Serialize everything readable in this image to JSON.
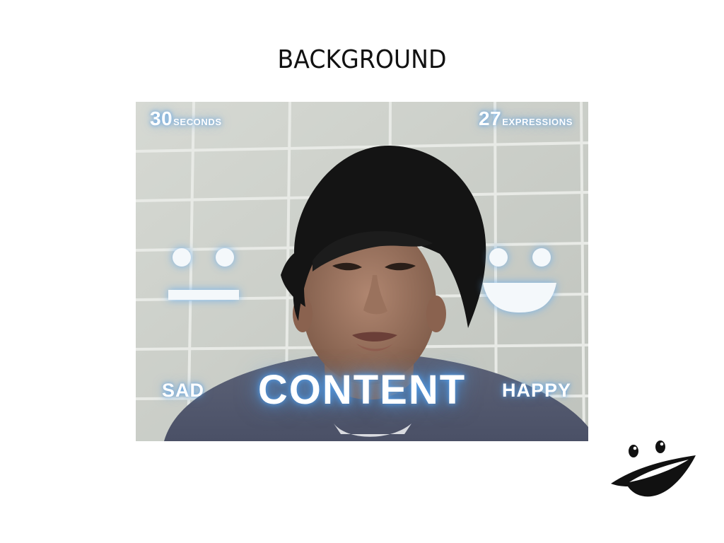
{
  "slide": {
    "title": "BACKGROUND"
  },
  "game": {
    "timer_value": "30",
    "timer_unit": "SECONDS",
    "expressions_value": "27",
    "expressions_unit": "EXPRESSIONS",
    "left_label": "SAD",
    "center_label": "CONTENT",
    "right_label": "HAPPY",
    "glow_color": "#5aa0e6",
    "left_icon": "neutral-face-icon",
    "right_icon": "smiling-face-icon"
  },
  "logo_icon": "smile-logo-icon"
}
